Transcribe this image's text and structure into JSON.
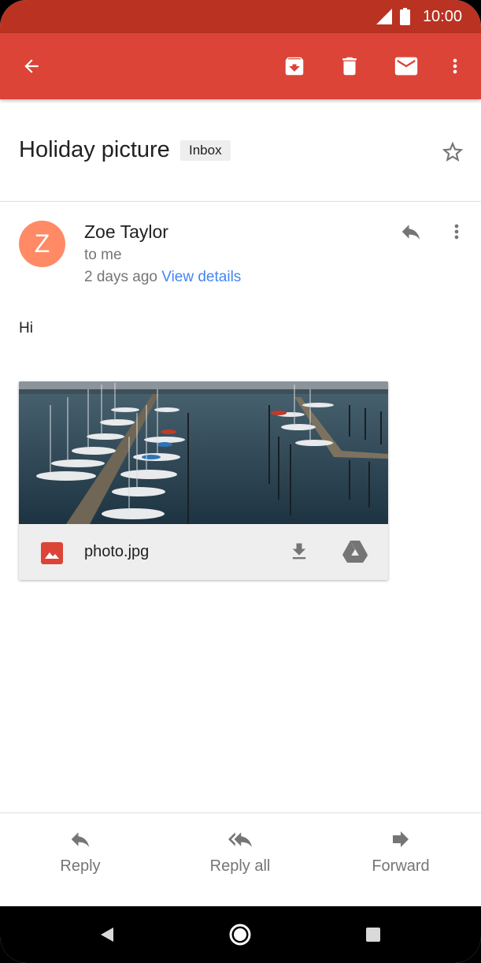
{
  "status_bar": {
    "time": "10:00"
  },
  "app_bar": {
    "icons": [
      "arrow-back-icon",
      "archive-icon",
      "delete-icon",
      "mark-unread-icon",
      "more-vert-icon"
    ]
  },
  "email": {
    "subject": "Holiday picture",
    "label": "Inbox",
    "sender_initial": "Z",
    "sender_name": "Zoe Taylor",
    "recipient": "to me",
    "time": "2 days ago",
    "view_details": "View details",
    "body": "Hi",
    "attachment": {
      "filename": "photo.jpg"
    }
  },
  "bottom_actions": {
    "reply": "Reply",
    "reply_all": "Reply all",
    "forward": "Forward"
  },
  "colors": {
    "app_bar": "#db4437",
    "status_bar": "#b93222",
    "avatar": "#ff8a65",
    "link": "#4285f4"
  }
}
